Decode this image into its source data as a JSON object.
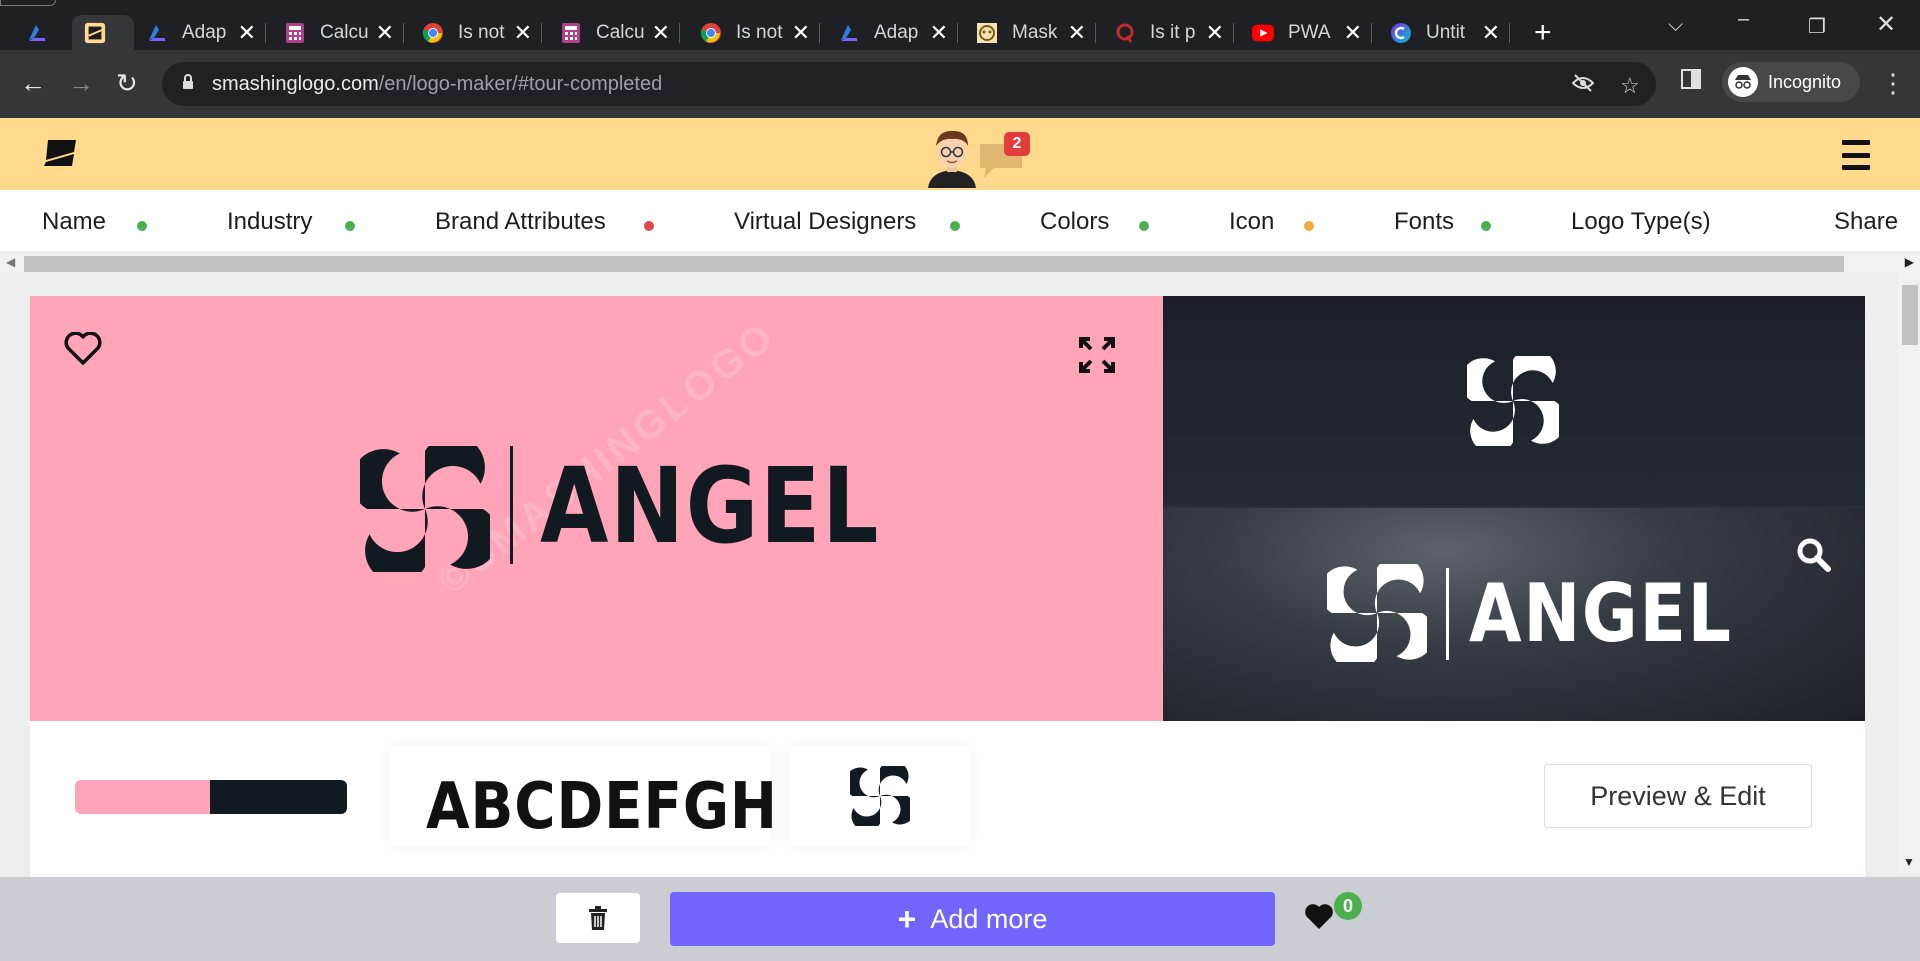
{
  "browser": {
    "tabs": [
      {
        "title": "",
        "icon": "azure-devops-icon"
      },
      {
        "title": "",
        "icon": "smashinglogo-icon",
        "active": true
      },
      {
        "title": "Adap",
        "icon": "azure-devops-icon"
      },
      {
        "title": "Calcu",
        "icon": "calculator-icon"
      },
      {
        "title": "Is not",
        "icon": "chrome-icon"
      },
      {
        "title": "Calcu",
        "icon": "calculator-icon"
      },
      {
        "title": "Is not",
        "icon": "chrome-icon"
      },
      {
        "title": "Adap",
        "icon": "azure-devops-icon"
      },
      {
        "title": "Mask",
        "icon": "mask-icon"
      },
      {
        "title": "Is it p",
        "icon": "quora-icon"
      },
      {
        "title": "PWA",
        "icon": "youtube-icon"
      },
      {
        "title": "Untit",
        "icon": "canva-icon"
      }
    ],
    "url_host": "smashinglogo.com",
    "url_path": "/en/logo-maker/#tour-completed",
    "profile_label": "Incognito"
  },
  "header": {
    "notification_count": "2"
  },
  "steps": [
    {
      "label": "Name",
      "status_color": "#4caf50"
    },
    {
      "label": "Industry",
      "status_color": "#4caf50"
    },
    {
      "label": "Brand Attributes",
      "status_color": "#e04848"
    },
    {
      "label": "Virtual Designers",
      "status_color": "#4caf50"
    },
    {
      "label": "Colors",
      "status_color": "#4caf50"
    },
    {
      "label": "Icon",
      "status_color": "#f0a93c"
    },
    {
      "label": "Fonts",
      "status_color": "#4caf50"
    },
    {
      "label": "Logo Type(s)",
      "status_color": ""
    },
    {
      "label": "Share",
      "status_color": ""
    }
  ],
  "preview": {
    "brand_name": "ANGEL",
    "watermark": "©SMASHINGLOGO",
    "colors": {
      "primary": "#ffa5b7",
      "secondary": "#111a20"
    },
    "font_sample": "ABCDEFGH",
    "preview_button": "Preview & Edit"
  },
  "bottom": {
    "add_more_label": "Add more",
    "favorites_count": "0"
  }
}
